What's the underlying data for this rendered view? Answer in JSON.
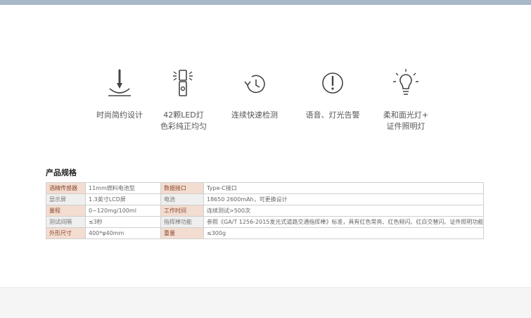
{
  "features": [
    {
      "icon": "pen-icon",
      "label": "时尚简约设计"
    },
    {
      "icon": "light-bar-icon",
      "label": "42颗LED灯\n色彩纯正均匀"
    },
    {
      "icon": "timer-refresh-icon",
      "label": "连续快速检测"
    },
    {
      "icon": "alert-icon",
      "label": "语音、灯光告警"
    },
    {
      "icon": "bulb-icon",
      "label": "柔和面光灯+\n证件照明灯"
    }
  ],
  "spec": {
    "title": "产品规格",
    "rows": [
      {
        "k1": "酒精传感器",
        "v1": "11mm燃料电池型",
        "k2": "数据接口",
        "v2": "Type-C接口"
      },
      {
        "k1": "显示屏",
        "v1": "1.3英寸LCD屏",
        "k2": "电池",
        "v2": "18650 2600mAh，可更换设计"
      },
      {
        "k1": "量程",
        "v1": "0~120mg/100ml",
        "k2": "工作时间",
        "v2": "连续测试>500次"
      },
      {
        "k1": "测试间隔",
        "v1": "≤3秒",
        "k2": "指挥棒功能",
        "v2": "参照《GA/T 1256-2015发光式道路交通指挥棒》标准，具有红色常亮、红色频闪、红白交替闪、证件照明功能"
      },
      {
        "k1": "外形尺寸",
        "v1": "400*φ40mm",
        "k2": "重量",
        "v2": "≤300g"
      }
    ]
  }
}
